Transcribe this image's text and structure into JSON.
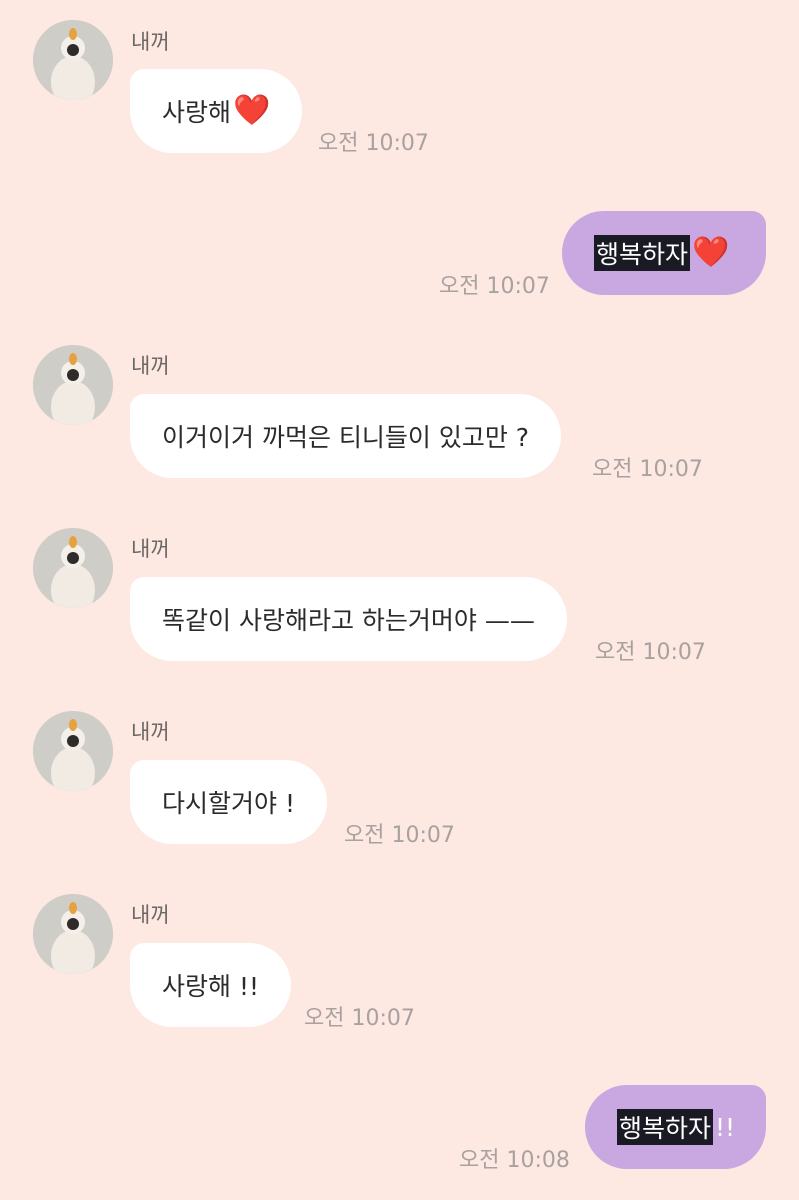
{
  "messages": [
    {
      "type": "in",
      "sender": "내꺼",
      "text": "사랑해",
      "emoji": "❤️",
      "time": "오전 10:07"
    },
    {
      "type": "out",
      "text": "행복하자",
      "emoji": "❤️",
      "time": "오전 10:07"
    },
    {
      "type": "in",
      "sender": "내꺼",
      "text": "이거이거 까먹은 티니들이 있고만 ?",
      "time": "오전 10:07"
    },
    {
      "type": "in",
      "sender": "내꺼",
      "text": "똑같이 사랑해라고 하는거머야 ——",
      "time": "오전 10:07"
    },
    {
      "type": "in",
      "sender": "내꺼",
      "text": "다시할거야 !",
      "time": "오전 10:07"
    },
    {
      "type": "in",
      "sender": "내꺼",
      "text": "사랑해 !!",
      "time": "오전 10:07"
    },
    {
      "type": "out",
      "text": "행복하자",
      "suffix": "!!",
      "time": "오전 10:08"
    }
  ],
  "colors": {
    "background": "#fde8e2",
    "incoming_bubble": "#ffffff",
    "outgoing_bubble": "#c9a7e0"
  }
}
